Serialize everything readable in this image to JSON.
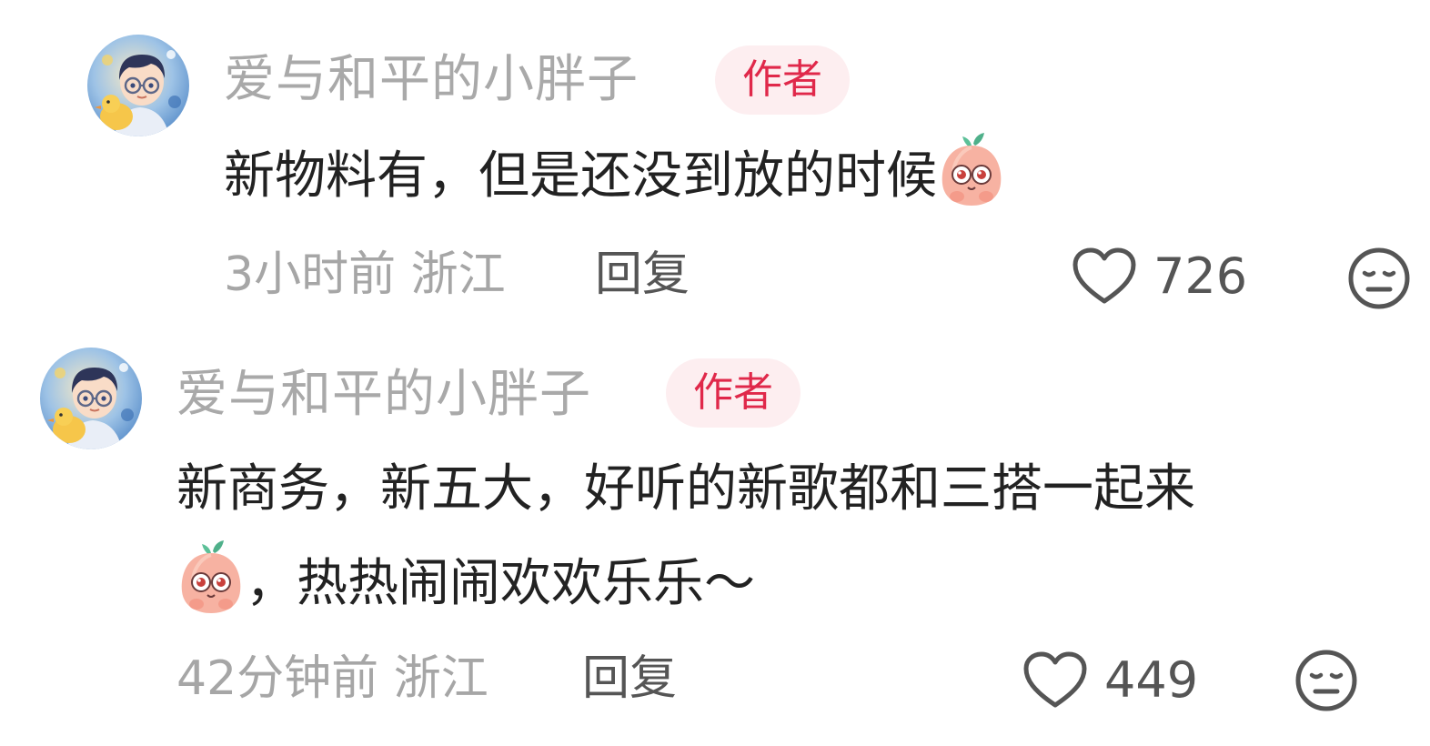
{
  "comments": [
    {
      "username": "爱与和平的小胖子",
      "badge": "作者",
      "content_before_emoji": "新物料有，但是还没到放的时候",
      "content_line2_before_emoji": "",
      "content_line2_after_emoji": "",
      "time": "3小时前",
      "location": "浙江",
      "reply_label": "回复",
      "likes": "726",
      "avatar_icon": "avatar-icon",
      "emoji_icon": "peach-emoji-icon"
    },
    {
      "username": "爱与和平的小胖子",
      "badge": "作者",
      "content_line1": "新商务，新五大，好听的新歌都和三搭一起来",
      "content_line2_after_emoji": "，热热闹闹欢欢乐乐～",
      "time": "42分钟前",
      "location": "浙江",
      "reply_label": "回复",
      "likes": "449",
      "avatar_icon": "avatar-icon",
      "emoji_icon": "peach-emoji-icon"
    }
  ],
  "colors": {
    "username": "#a9a9a9",
    "badge_text": "#e0284a",
    "badge_bg": "#fdeef0",
    "content": "#222222",
    "meta": "#a6a6a6",
    "reply": "#555555"
  }
}
